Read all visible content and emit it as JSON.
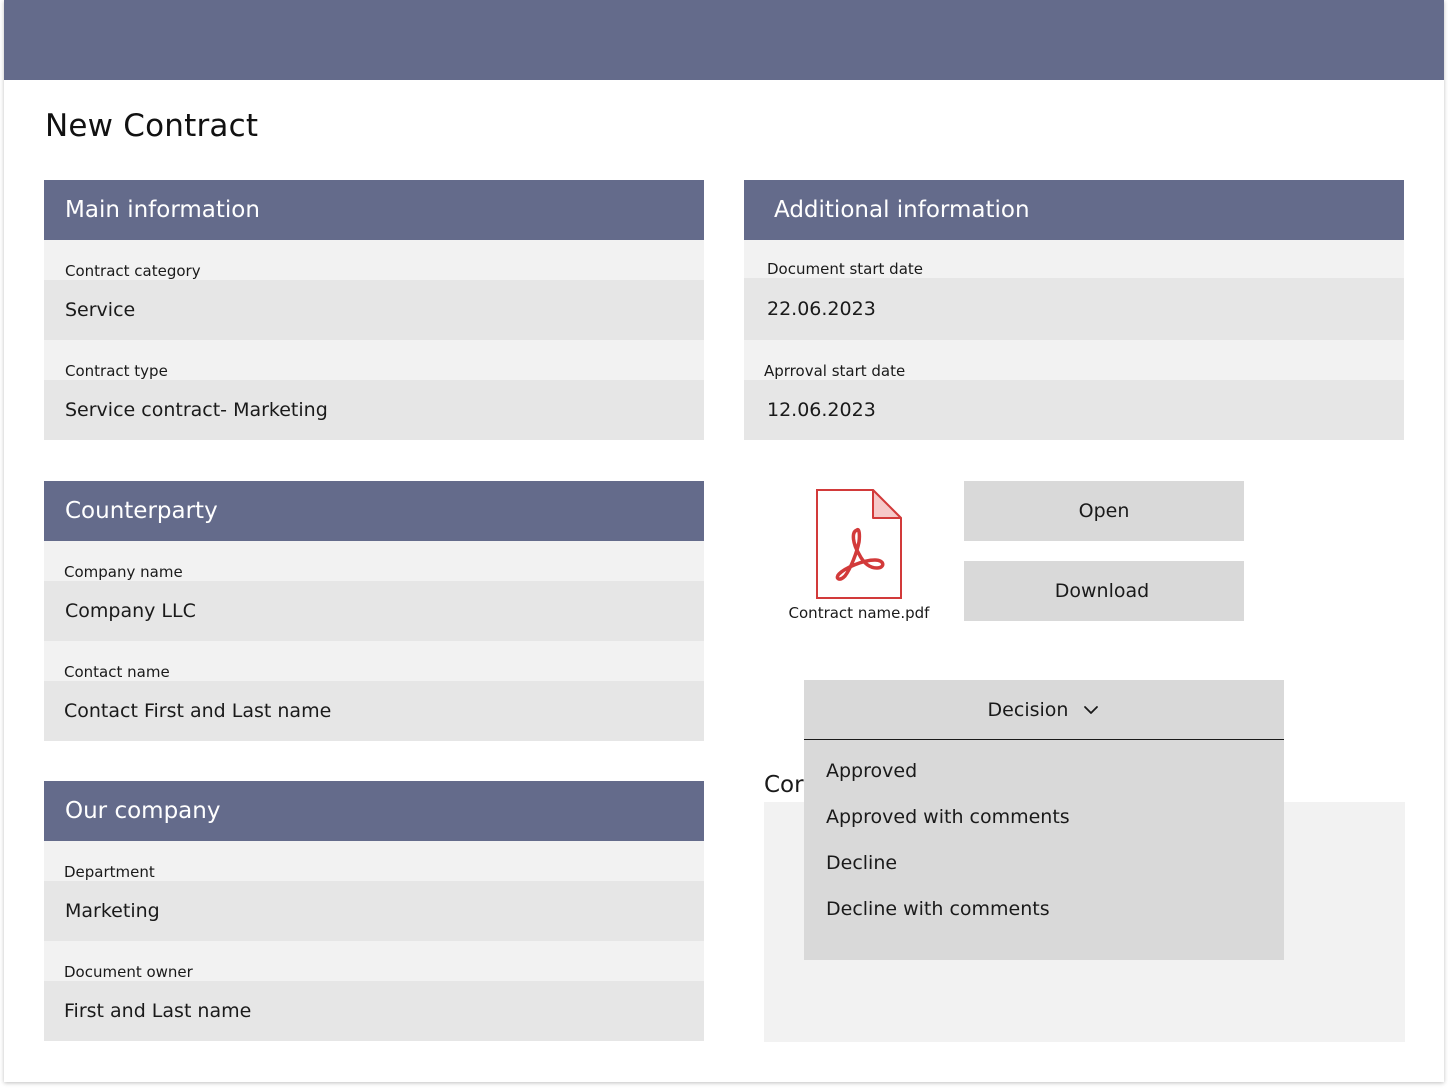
{
  "page": {
    "title": "New Contract"
  },
  "main_info": {
    "header": "Main information",
    "fields": [
      {
        "label": "Contract category",
        "value": "Service"
      },
      {
        "label": "Contract type",
        "value": "Service contract- Marketing"
      }
    ]
  },
  "additional_info": {
    "header": "Additional information",
    "fields": [
      {
        "label": "Document start date",
        "value": "22.06.2023"
      },
      {
        "label": "Aprroval start date",
        "value": "12.06.2023"
      }
    ]
  },
  "counterparty": {
    "header": "Counterparty",
    "fields": [
      {
        "label": "Company name",
        "value": "Company LLC"
      },
      {
        "label": "Contact name",
        "value": "Contact First and Last name"
      }
    ]
  },
  "our_company": {
    "header": "Our company",
    "fields": [
      {
        "label": "Department",
        "value": "Marketing"
      },
      {
        "label": "Document owner",
        "value": "First and Last name"
      }
    ]
  },
  "attachment": {
    "file_name": "Contract name.pdf",
    "icon": "pdf-file-icon",
    "open_label": "Open",
    "download_label": "Download"
  },
  "comments": {
    "label": "Cor"
  },
  "decision": {
    "label": "Decision",
    "options": [
      "Approved",
      "Approved with comments",
      "Decline",
      "Decline with comments"
    ]
  },
  "colors": {
    "header_bar": "#646b8b",
    "field_label_bg": "#f2f2f2",
    "field_value_bg": "#e6e6e6",
    "button_bg": "#d9d9d9",
    "pdf_red": "#d23a3a"
  }
}
